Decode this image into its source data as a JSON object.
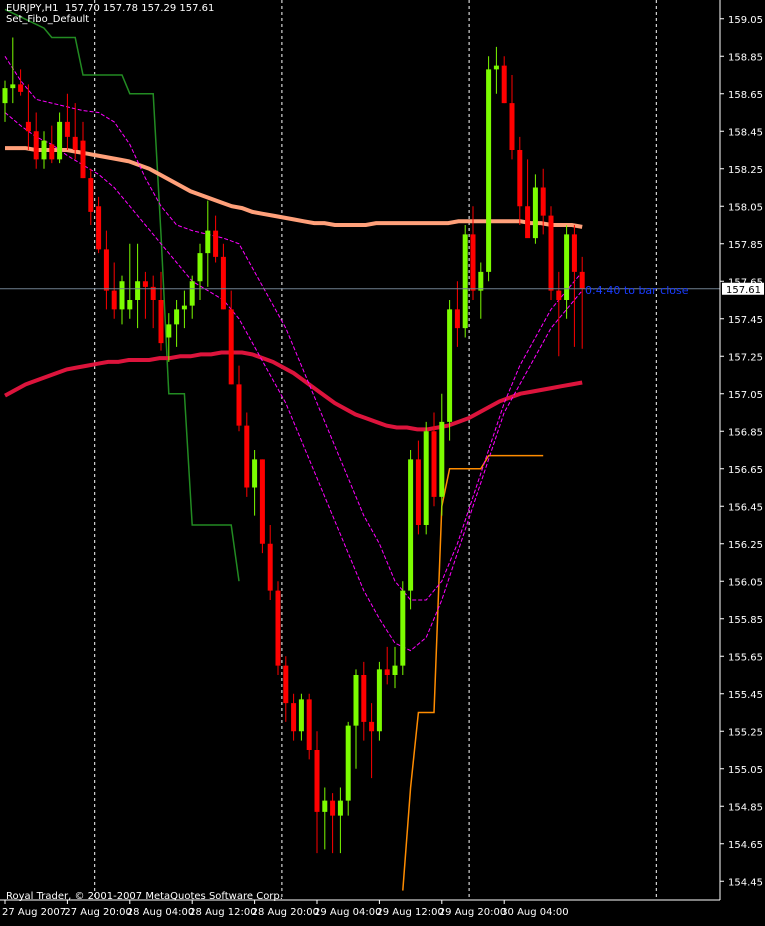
{
  "header": {
    "symbol_line": "EURJPY,H1  157.70 157.78 157.29 157.61",
    "template_name": "Set_Fibo_Default"
  },
  "timer_text": "0:4:40 to bar close",
  "copyright": "Royal Trader, © 2001-2007 MetaQuotes Software Corp.",
  "colors": {
    "background": "#000000",
    "axis": "#ffffff",
    "bull": "#7cfc00",
    "bear": "#ff0000",
    "ma_slow": "#dc143c",
    "ma_mid": "#ffa07a",
    "fast_envelope": "#ff00ff",
    "stop_green": "#228b22",
    "stop_orange": "#ff8c00",
    "price_line": "#708090",
    "timer": "#1a3cff"
  },
  "chart_data": {
    "type": "candlestick",
    "symbol": "EURJPY",
    "timeframe": "H1",
    "current_price": 157.61,
    "current_price_label": "157.61",
    "ylim": [
      154.35,
      159.15
    ],
    "y_ticks": [
      "159.05",
      "158.85",
      "158.65",
      "158.45",
      "158.25",
      "158.05",
      "157.85",
      "157.65",
      "157.45",
      "157.25",
      "157.05",
      "156.85",
      "156.65",
      "156.45",
      "156.25",
      "156.05",
      "155.85",
      "155.65",
      "155.45",
      "155.25",
      "155.05",
      "154.85",
      "154.65",
      "154.45"
    ],
    "x_ticks": [
      {
        "index": 0,
        "label": "27 Aug 2007"
      },
      {
        "index": 8,
        "label": "27 Aug 20:00"
      },
      {
        "index": 16,
        "label": "28 Aug 04:00"
      },
      {
        "index": 24,
        "label": "28 Aug 12:00"
      },
      {
        "index": 32,
        "label": "28 Aug 20:00"
      },
      {
        "index": 40,
        "label": "29 Aug 04:00"
      },
      {
        "index": 48,
        "label": "29 Aug 12:00"
      },
      {
        "index": 56,
        "label": "29 Aug 20:00"
      },
      {
        "index": 64,
        "label": "30 Aug 04:00"
      }
    ],
    "session_separator_indices": [
      12,
      36,
      60,
      84
    ],
    "candles": [
      [
        158.6,
        158.72,
        158.5,
        158.68
      ],
      [
        158.68,
        158.95,
        158.6,
        158.7
      ],
      [
        158.7,
        158.78,
        158.64,
        158.66
      ],
      [
        158.5,
        158.7,
        158.35,
        158.45
      ],
      [
        158.45,
        158.55,
        158.25,
        158.3
      ],
      [
        158.3,
        158.45,
        158.25,
        158.4
      ],
      [
        158.38,
        158.48,
        158.28,
        158.3
      ],
      [
        158.3,
        158.55,
        158.28,
        158.5
      ],
      [
        158.5,
        158.65,
        158.35,
        158.42
      ],
      [
        158.42,
        158.6,
        158.3,
        158.35
      ],
      [
        158.4,
        158.5,
        158.2,
        158.2
      ],
      [
        158.2,
        158.25,
        157.95,
        158.02
      ],
      [
        158.05,
        158.1,
        157.8,
        157.82
      ],
      [
        157.82,
        157.92,
        157.5,
        157.6
      ],
      [
        157.6,
        157.75,
        157.45,
        157.5
      ],
      [
        157.5,
        157.68,
        157.42,
        157.65
      ],
      [
        157.5,
        157.85,
        157.45,
        157.55
      ],
      [
        157.55,
        157.85,
        157.4,
        157.65
      ],
      [
        157.65,
        157.7,
        157.45,
        157.62
      ],
      [
        157.62,
        157.68,
        157.4,
        157.55
      ],
      [
        157.55,
        157.7,
        157.28,
        157.32
      ],
      [
        157.35,
        157.48,
        157.22,
        157.42
      ],
      [
        157.42,
        157.55,
        157.3,
        157.5
      ],
      [
        157.5,
        157.6,
        157.4,
        157.52
      ],
      [
        157.52,
        157.68,
        157.45,
        157.65
      ],
      [
        157.65,
        157.85,
        157.55,
        157.8
      ],
      [
        157.8,
        158.08,
        157.62,
        157.92
      ],
      [
        157.92,
        158.0,
        157.75,
        157.78
      ],
      [
        157.78,
        157.85,
        157.5,
        157.5
      ],
      [
        157.5,
        157.6,
        157.1,
        157.1
      ],
      [
        157.1,
        157.2,
        156.85,
        156.88
      ],
      [
        156.88,
        156.95,
        156.5,
        156.55
      ],
      [
        156.55,
        156.75,
        156.4,
        156.7
      ],
      [
        156.7,
        156.7,
        156.2,
        156.25
      ],
      [
        156.25,
        156.35,
        155.95,
        156.0
      ],
      [
        156.0,
        156.05,
        155.55,
        155.6
      ],
      [
        155.6,
        155.65,
        155.3,
        155.4
      ],
      [
        155.4,
        155.45,
        155.2,
        155.25
      ],
      [
        155.25,
        155.45,
        155.2,
        155.42
      ],
      [
        155.42,
        155.45,
        155.1,
        155.15
      ],
      [
        155.15,
        155.25,
        154.6,
        154.82
      ],
      [
        154.82,
        154.95,
        154.62,
        154.88
      ],
      [
        154.88,
        154.92,
        154.6,
        154.8
      ],
      [
        154.8,
        154.95,
        154.6,
        154.88
      ],
      [
        154.88,
        155.3,
        154.8,
        155.28
      ],
      [
        155.28,
        155.58,
        155.05,
        155.55
      ],
      [
        155.55,
        155.62,
        155.2,
        155.3
      ],
      [
        155.3,
        155.4,
        155.0,
        155.25
      ],
      [
        155.25,
        155.62,
        155.2,
        155.58
      ],
      [
        155.58,
        155.7,
        155.5,
        155.55
      ],
      [
        155.55,
        155.7,
        155.48,
        155.6
      ],
      [
        155.6,
        156.05,
        155.55,
        156.0
      ],
      [
        156.0,
        156.75,
        155.9,
        156.7
      ],
      [
        156.7,
        156.8,
        156.3,
        156.35
      ],
      [
        156.35,
        156.9,
        156.3,
        156.85
      ],
      [
        156.85,
        156.95,
        156.45,
        156.5
      ],
      [
        156.5,
        157.05,
        156.4,
        156.9
      ],
      [
        156.9,
        157.55,
        156.8,
        157.5
      ],
      [
        157.5,
        157.65,
        157.3,
        157.4
      ],
      [
        157.4,
        157.95,
        157.35,
        157.9
      ],
      [
        157.9,
        158.05,
        157.55,
        157.6
      ],
      [
        157.6,
        157.75,
        157.45,
        157.7
      ],
      [
        157.7,
        158.85,
        157.65,
        158.78
      ],
      [
        158.78,
        158.9,
        158.65,
        158.8
      ],
      [
        158.8,
        158.85,
        158.6,
        158.6
      ],
      [
        158.6,
        158.75,
        158.3,
        158.35
      ],
      [
        158.35,
        158.42,
        157.95,
        158.05
      ],
      [
        158.05,
        158.3,
        157.95,
        157.88
      ],
      [
        157.88,
        158.22,
        157.85,
        158.15
      ],
      [
        158.15,
        158.25,
        157.9,
        158.0
      ],
      [
        158.0,
        158.05,
        157.55,
        157.6
      ],
      [
        157.6,
        157.7,
        157.25,
        157.55
      ],
      [
        157.55,
        157.95,
        157.45,
        157.9
      ],
      [
        157.9,
        157.95,
        157.3,
        157.7
      ],
      [
        157.7,
        157.78,
        157.29,
        157.61
      ]
    ],
    "ma_red_200": [
      157.04,
      157.07,
      157.1,
      157.12,
      157.14,
      157.16,
      157.18,
      157.19,
      157.2,
      157.21,
      157.22,
      157.22,
      157.23,
      157.23,
      157.23,
      157.24,
      157.24,
      157.25,
      157.25,
      157.26,
      157.26,
      157.27,
      157.27,
      157.27,
      157.26,
      157.24,
      157.22,
      157.19,
      157.16,
      157.12,
      157.08,
      157.04,
      157.0,
      156.97,
      156.94,
      156.92,
      156.9,
      156.88,
      156.87,
      156.87,
      156.86,
      156.86,
      156.87,
      156.88,
      156.9,
      156.92,
      156.95,
      156.98,
      157.01,
      157.03,
      157.05,
      157.06,
      157.07,
      157.08,
      157.09,
      157.1,
      157.11
    ],
    "ma_salmon_100": [
      158.36,
      158.36,
      158.36,
      158.35,
      158.35,
      158.35,
      158.35,
      158.34,
      158.33,
      158.32,
      158.31,
      158.3,
      158.29,
      158.27,
      158.25,
      158.22,
      158.19,
      158.16,
      158.13,
      158.11,
      158.09,
      158.07,
      158.05,
      158.04,
      158.02,
      158.01,
      158.0,
      157.99,
      157.98,
      157.97,
      157.96,
      157.96,
      157.95,
      157.95,
      157.95,
      157.95,
      157.96,
      157.96,
      157.96,
      157.96,
      157.96,
      157.96,
      157.96,
      157.96,
      157.97,
      157.97,
      157.97,
      157.97,
      157.97,
      157.97,
      157.97,
      157.96,
      157.96,
      157.95,
      157.95,
      157.95,
      157.94
    ],
    "env_upper": [
      158.85,
      158.72,
      158.62,
      158.6,
      158.58,
      158.56,
      158.55,
      158.5,
      158.38,
      158.2,
      158.05,
      157.95,
      157.92,
      157.9,
      157.88,
      157.85,
      157.7,
      157.55,
      157.4,
      157.2,
      157.0,
      156.8,
      156.6,
      156.4,
      156.25,
      156.05,
      155.95,
      155.95,
      156.05,
      156.25,
      156.5,
      156.75,
      157.0,
      157.2,
      157.35,
      157.5,
      157.6,
      157.7
    ],
    "env_lower": [
      158.55,
      158.48,
      158.42,
      158.38,
      158.32,
      158.27,
      158.22,
      158.15,
      158.05,
      157.95,
      157.85,
      157.75,
      157.65,
      157.6,
      157.55,
      157.45,
      157.3,
      157.15,
      157.0,
      156.8,
      156.6,
      156.4,
      156.2,
      156.0,
      155.85,
      155.72,
      155.68,
      155.75,
      155.95,
      156.2,
      156.45,
      156.7,
      156.95,
      157.1,
      157.25,
      157.4,
      157.5,
      157.6
    ],
    "stop_green_steps": [
      [
        0,
        159.1
      ],
      [
        5,
        159.0
      ],
      [
        6,
        158.95
      ],
      [
        9,
        158.95
      ],
      [
        10,
        158.75
      ],
      [
        15,
        158.75
      ],
      [
        16,
        158.65
      ],
      [
        19,
        158.65
      ],
      [
        20,
        157.9
      ],
      [
        21,
        157.05
      ],
      [
        23,
        157.05
      ],
      [
        24,
        156.35
      ],
      [
        29,
        156.35
      ],
      [
        30,
        156.05
      ]
    ],
    "stop_orange_steps": [
      [
        51,
        154.4
      ],
      [
        52,
        154.95
      ],
      [
        53,
        155.35
      ],
      [
        55,
        155.35
      ],
      [
        56,
        156.45
      ],
      [
        57,
        156.65
      ],
      [
        61,
        156.65
      ],
      [
        62,
        156.72
      ],
      [
        69,
        156.72
      ]
    ]
  }
}
